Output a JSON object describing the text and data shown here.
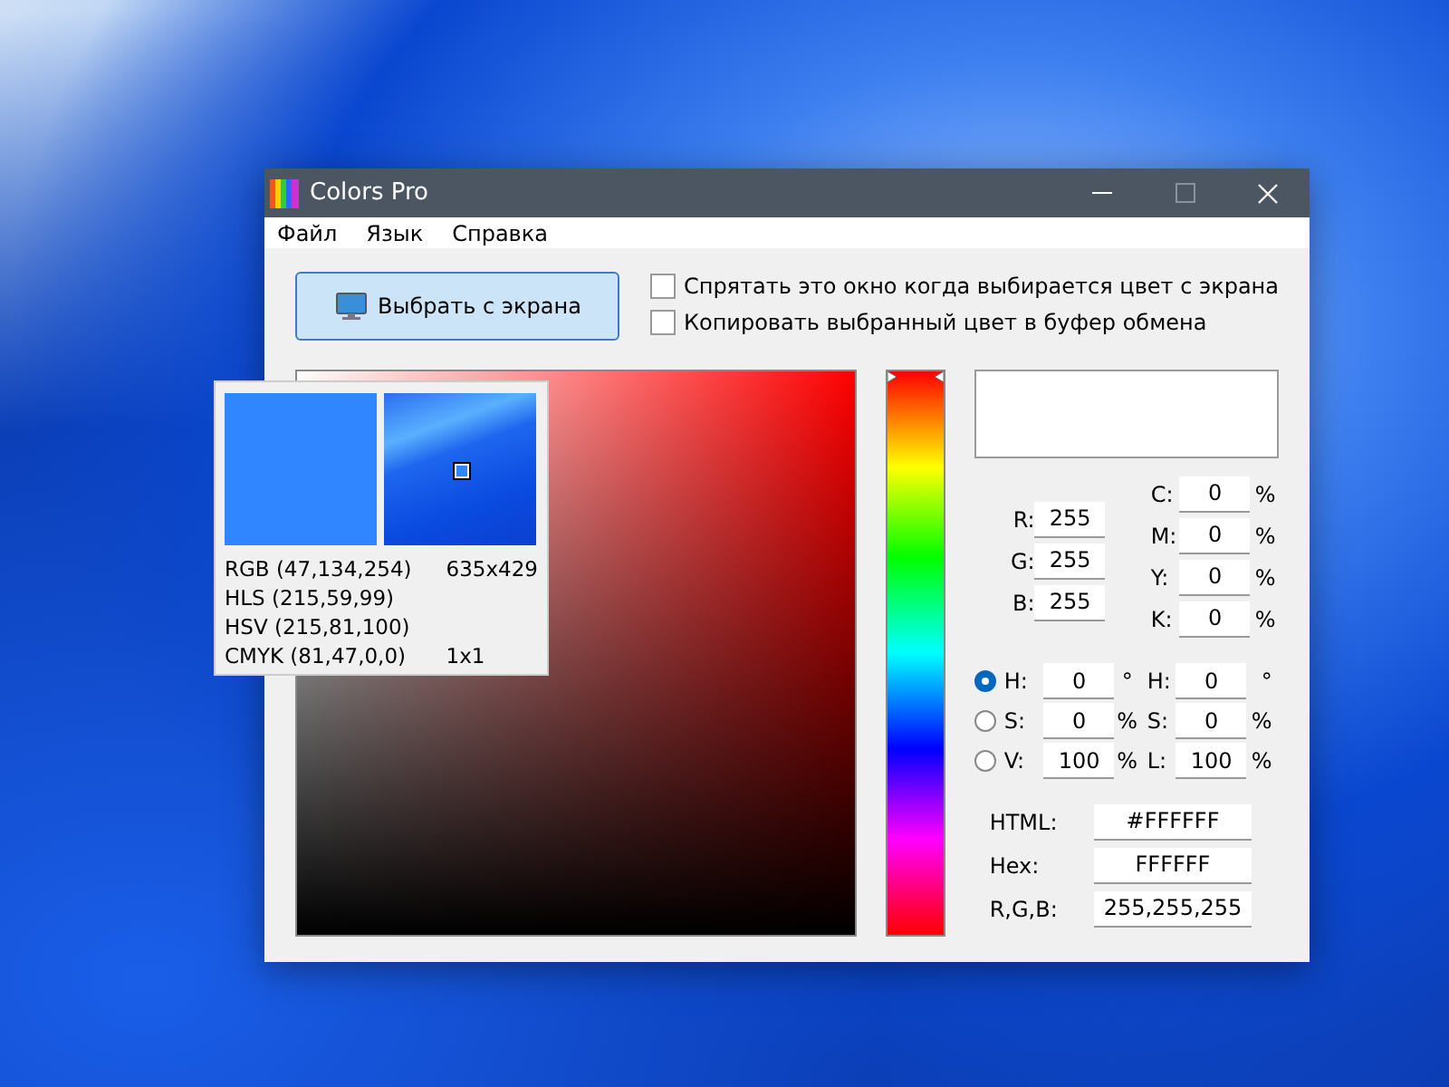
{
  "window": {
    "title": "Colors Pro"
  },
  "menu": [
    "Файл",
    "Язык",
    "Справка"
  ],
  "pick_button": {
    "label": "Выбрать с экрана"
  },
  "hue_slider": {
    "level": 0
  },
  "options": [
    {
      "label": "Спрятать это окно когда выбирается цвет с экрана",
      "checked": false
    },
    {
      "label": "Копировать выбранный цвет в буфер обмена",
      "checked": false
    }
  ],
  "rgb": [
    {
      "label": "R:",
      "value": "255"
    },
    {
      "label": "G:",
      "value": "255"
    },
    {
      "label": "B:",
      "value": "255"
    }
  ],
  "cmyk": [
    {
      "label": "C:",
      "value": "0",
      "unit": "%"
    },
    {
      "label": "M:",
      "value": "0",
      "unit": "%"
    },
    {
      "label": "Y:",
      "value": "0",
      "unit": "%"
    },
    {
      "label": "K:",
      "value": "0",
      "unit": "%"
    }
  ],
  "hsv": [
    {
      "label": "H:",
      "value": "0",
      "unit": "°",
      "selected": true
    },
    {
      "label": "S:",
      "value": "0",
      "unit": "%",
      "selected": false
    },
    {
      "label": "V:",
      "value": "100",
      "unit": "%",
      "selected": false
    }
  ],
  "hsl": [
    {
      "label": "H:",
      "value": "0",
      "unit": "°"
    },
    {
      "label": "S:",
      "value": "0",
      "unit": "%"
    },
    {
      "label": "L:",
      "value": "100",
      "unit": "%"
    }
  ],
  "codes": [
    {
      "label": "HTML:",
      "value": "#FFFFFF"
    },
    {
      "label": "Hex:",
      "value": "FFFFFF"
    },
    {
      "label": "R,G,B:",
      "value": "255,255,255"
    }
  ],
  "magnifier": {
    "rgb": "RGB (47,134,254)",
    "position": "635x429",
    "hls": "HLS (215,59,99)",
    "hsv": "HSV (215,81,100)",
    "cmyk": "CMYK (81,47,0,0)",
    "zoom": "1x1"
  }
}
